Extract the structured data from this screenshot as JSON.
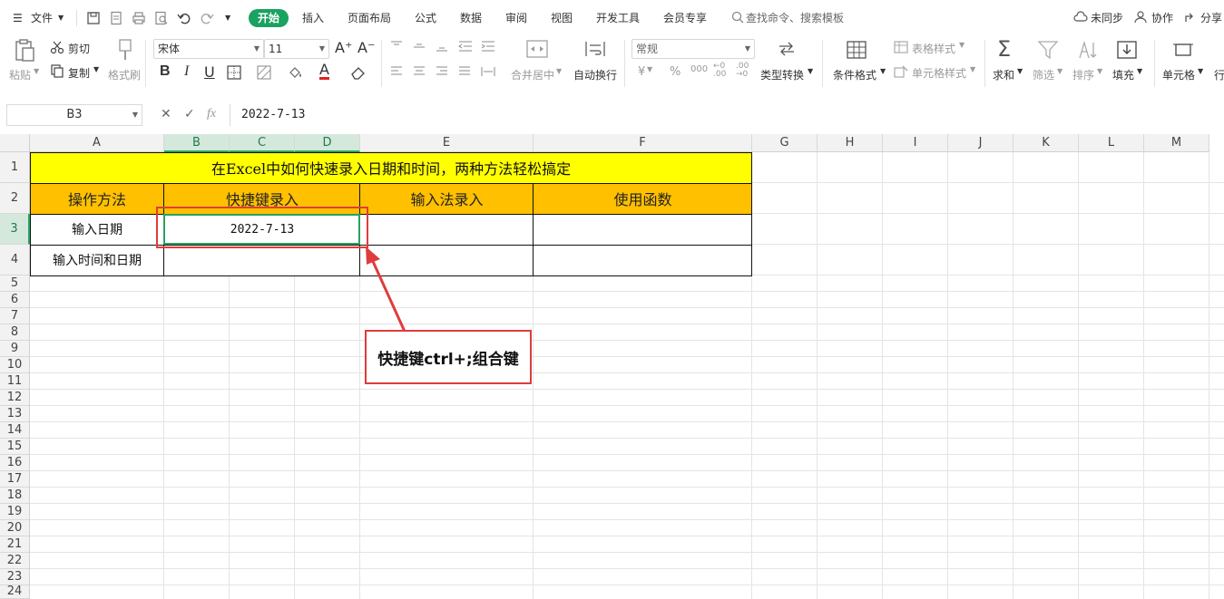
{
  "menubar": {
    "file_label": "文件",
    "tabs": [
      "开始",
      "插入",
      "页面布局",
      "公式",
      "数据",
      "审阅",
      "视图",
      "开发工具",
      "会员专享"
    ],
    "search_placeholder": "查找命令、搜索模板",
    "sync_label": "未同步",
    "collab_label": "协作",
    "share_label": "分享"
  },
  "ribbon": {
    "paste": "粘贴",
    "cut": "剪切",
    "copy": "复制",
    "format_painter": "格式刷",
    "font_name": "宋体",
    "font_size": "11",
    "merge_center": "合并居中",
    "wrap_text": "自动换行",
    "number_format": "常规",
    "type_convert": "类型转换",
    "conditional_format": "条件格式",
    "table_style": "表格样式",
    "cell_style": "单元格样式",
    "sum": "求和",
    "filter": "筛选",
    "sort": "排序",
    "fill": "填充",
    "cell": "单元格",
    "row_col": "行",
    "currency_symbol": "¥",
    "percent_symbol": "%",
    "thousands": "000",
    "font_color": "#e02020"
  },
  "formula_bar": {
    "name_box": "B3",
    "fx": "fx",
    "value": "2022-7-13"
  },
  "grid": {
    "columns": [
      "A",
      "B",
      "C",
      "D",
      "E",
      "F",
      "G",
      "H",
      "I",
      "J",
      "K",
      "L",
      "M"
    ],
    "rows": [
      "1",
      "2",
      "3",
      "4",
      "5",
      "6",
      "7",
      "8",
      "9",
      "10",
      "11",
      "12",
      "13",
      "14",
      "15",
      "16",
      "17",
      "18",
      "19",
      "20",
      "21",
      "22",
      "23",
      "24"
    ],
    "title": "在Excel中如何快速录入日期和时间，两种方法轻松搞定",
    "headers": [
      "操作方法",
      "快捷键录入",
      "输入法录入",
      "使用函数"
    ],
    "row3": [
      "输入日期",
      "2022-7-13",
      "",
      ""
    ],
    "row4": [
      "输入时间和日期",
      "",
      "",
      ""
    ]
  },
  "annotation": {
    "text": "快捷键ctrl+;组合键"
  },
  "colors": {
    "title_fill": "#ffff00",
    "header_fill": "#ffc000",
    "accent_green": "#1aa260",
    "annotation_red": "#e03c3c"
  }
}
